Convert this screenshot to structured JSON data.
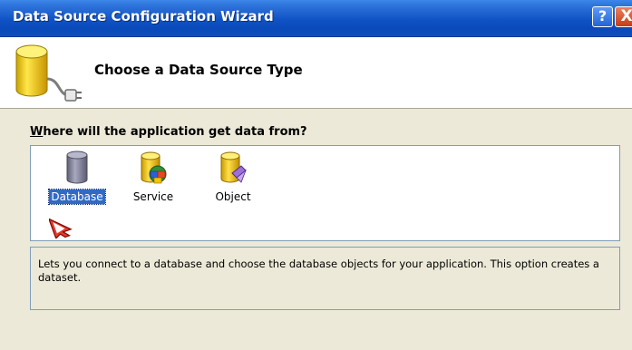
{
  "window": {
    "title": "Data Source Configuration Wizard",
    "help_button": "?",
    "close_button": "X"
  },
  "header": {
    "title": "Choose a Data Source Type",
    "icon": "database-plug-icon"
  },
  "question": "Where will the application get data from?",
  "question_mnemonic": "W",
  "source_types": [
    {
      "label": "Database",
      "icon": "database-icon",
      "selected": true
    },
    {
      "label": "Service",
      "icon": "service-icon",
      "selected": false
    },
    {
      "label": "Object",
      "icon": "object-icon",
      "selected": false
    }
  ],
  "description": "Lets you connect to a database and choose the database objects for your application. This option creates a dataset.",
  "colors": {
    "title_bar": "#0a4fc3",
    "selection": "#316ac5",
    "dialog_background": "#ece9d8",
    "close_button": "#d54a22"
  }
}
